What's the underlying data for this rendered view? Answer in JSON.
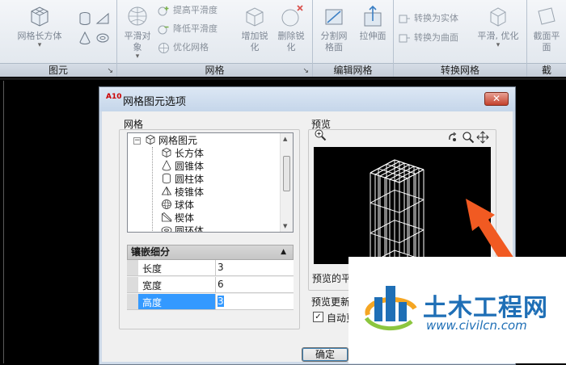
{
  "ribbon": {
    "panels": [
      {
        "label": "图元",
        "tools": [
          {
            "label": "网格长方体",
            "icon": "mesh-box-icon"
          }
        ]
      },
      {
        "label": "网格",
        "tools": [
          {
            "label": "平滑对象",
            "icon": "smooth-object-icon"
          },
          {
            "label": "提高平滑度",
            "icon": "smooth-more-icon"
          },
          {
            "label": "降低平滑度",
            "icon": "smooth-less-icon"
          },
          {
            "label": "优化网格",
            "icon": "refine-mesh-icon"
          },
          {
            "label": "增加锐化",
            "icon": "add-crease-icon"
          },
          {
            "label": "删除锐化",
            "icon": "remove-crease-icon"
          }
        ]
      },
      {
        "label": "编辑网格",
        "tools": [
          {
            "label": "分割网格面",
            "icon": "split-face-icon"
          },
          {
            "label": "拉伸面",
            "icon": "extrude-face-icon"
          }
        ]
      },
      {
        "label": "转换网格",
        "tools": [
          {
            "label": "转换为实体",
            "icon": "convert-solid-icon"
          },
          {
            "label": "转换为曲面",
            "icon": "convert-surface-icon"
          },
          {
            "label": "平滑, 优化",
            "icon": "smooth-optimize-icon"
          }
        ]
      },
      {
        "label": "截",
        "tools": [
          {
            "label": "截面平面",
            "icon": "section-plane-icon"
          }
        ]
      }
    ]
  },
  "dialog": {
    "app_icon": "A10",
    "title": "网格图元选项",
    "close_label": "✕",
    "mesh_group_label": "网格",
    "tree": {
      "root": "网格图元",
      "items": [
        "长方体",
        "圆锥体",
        "圆柱体",
        "棱锥体",
        "球体",
        "楔体",
        "圆环体"
      ]
    },
    "properties": {
      "header": "镶嵌细分",
      "rows": [
        {
          "name": "长度",
          "value": "3"
        },
        {
          "name": "宽度",
          "value": "6"
        },
        {
          "name": "高度",
          "value": "3"
        }
      ]
    },
    "preview_label": "预览",
    "preview_caption": "预览的平",
    "update_label": "预览更新",
    "auto_update_label": "自动更",
    "auto_update_checked": true,
    "ok_label": "确定"
  },
  "watermark": {
    "title": "土木工程网",
    "url": "www.civilcn.com"
  },
  "colors": {
    "selection": "#3399ff",
    "watermark_blue": "#1f6fb6",
    "arrow": "#f15a22"
  }
}
